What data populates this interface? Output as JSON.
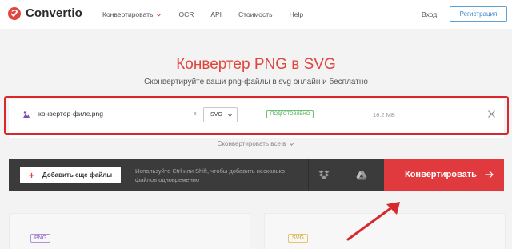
{
  "header": {
    "logo_text": "Convertio",
    "nav": [
      {
        "label": "Конвертировать",
        "has_dropdown": true
      },
      {
        "label": "OCR"
      },
      {
        "label": "API"
      },
      {
        "label": "Стоимость"
      },
      {
        "label": "Help"
      }
    ],
    "login_label": "Вход",
    "register_label": "Регистрация"
  },
  "hero": {
    "title": "Конвертер PNG в SVG",
    "subtitle": "Сконвертируйте ваши png-файлы в svg онлайн и бесплатно"
  },
  "file": {
    "name": "конвертер-филе.png",
    "in_label": "в",
    "format": "SVG",
    "status": "ПОДГОТОВЛЕНО",
    "size": "16.2 MB"
  },
  "convert_all_label": "Сконвертировать все в",
  "action_bar": {
    "add_files_label": "Добавить еще файлы",
    "hint": "Используйте Ctrl или Shift, чтобы добавить несколько файлов одновременно",
    "convert_label": "Конвертировать"
  },
  "formats": {
    "from": "PNG",
    "to": "SVG"
  },
  "colors": {
    "accent": "#e0463d",
    "convert_button": "#e03a3e",
    "action_bar": "#3b3b3b",
    "highlight": "#d9272e"
  }
}
